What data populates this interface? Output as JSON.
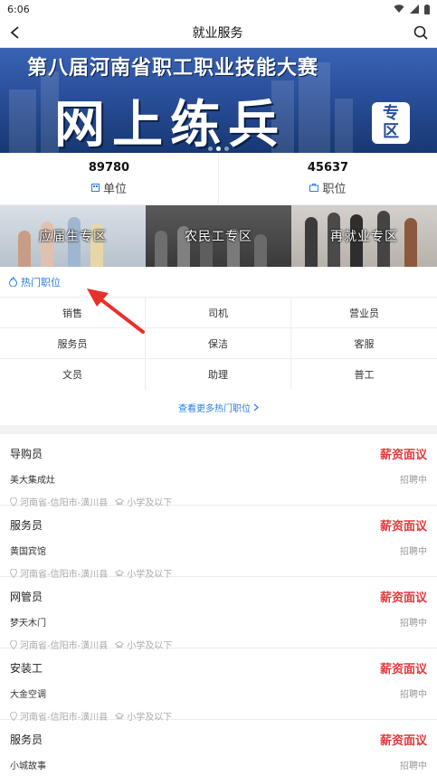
{
  "status_bar": {
    "time": "6:06"
  },
  "nav": {
    "title": "就业服务"
  },
  "banner": {
    "line1": "第八届河南省职工职业技能大赛",
    "line2": "网上练兵",
    "badge_line1": "专",
    "badge_line2": "区"
  },
  "stats": [
    {
      "value": "89780",
      "label": "单位"
    },
    {
      "value": "45637",
      "label": "职位"
    }
  ],
  "zones": [
    {
      "label": "应届生专区"
    },
    {
      "label": "农民工专区"
    },
    {
      "label": "再就业专区"
    }
  ],
  "hot": {
    "title": "热门职位",
    "items": [
      "销售",
      "司机",
      "营业员",
      "服务员",
      "保洁",
      "客服",
      "文员",
      "助理",
      "普工"
    ],
    "more": "查看更多热门职位"
  },
  "jobs": [
    {
      "title": "导购员",
      "salary": "薪资面议",
      "company": "美大集成灶",
      "status": "招聘中",
      "location": "河南省-信阳市-潢川县",
      "education": "小学及以下"
    },
    {
      "title": "服务员",
      "salary": "薪资面议",
      "company": "黄国宾馆",
      "status": "招聘中",
      "location": "河南省-信阳市-潢川县",
      "education": "小学及以下"
    },
    {
      "title": "网管员",
      "salary": "薪资面议",
      "company": "梦天木门",
      "status": "招聘中",
      "location": "河南省-信阳市-潢川县",
      "education": "小学及以下"
    },
    {
      "title": "安装工",
      "salary": "薪资面议",
      "company": "大金空调",
      "status": "招聘中",
      "location": "河南省-信阳市-潢川县",
      "education": "小学及以下"
    },
    {
      "title": "服务员",
      "salary": "薪资面议",
      "company": "小城故事",
      "status": "招聘中",
      "location": "",
      "education": ""
    }
  ],
  "colors": {
    "accent": "#2a7de1",
    "salary": "#e4393c",
    "annotation_arrow": "#e8302b"
  }
}
